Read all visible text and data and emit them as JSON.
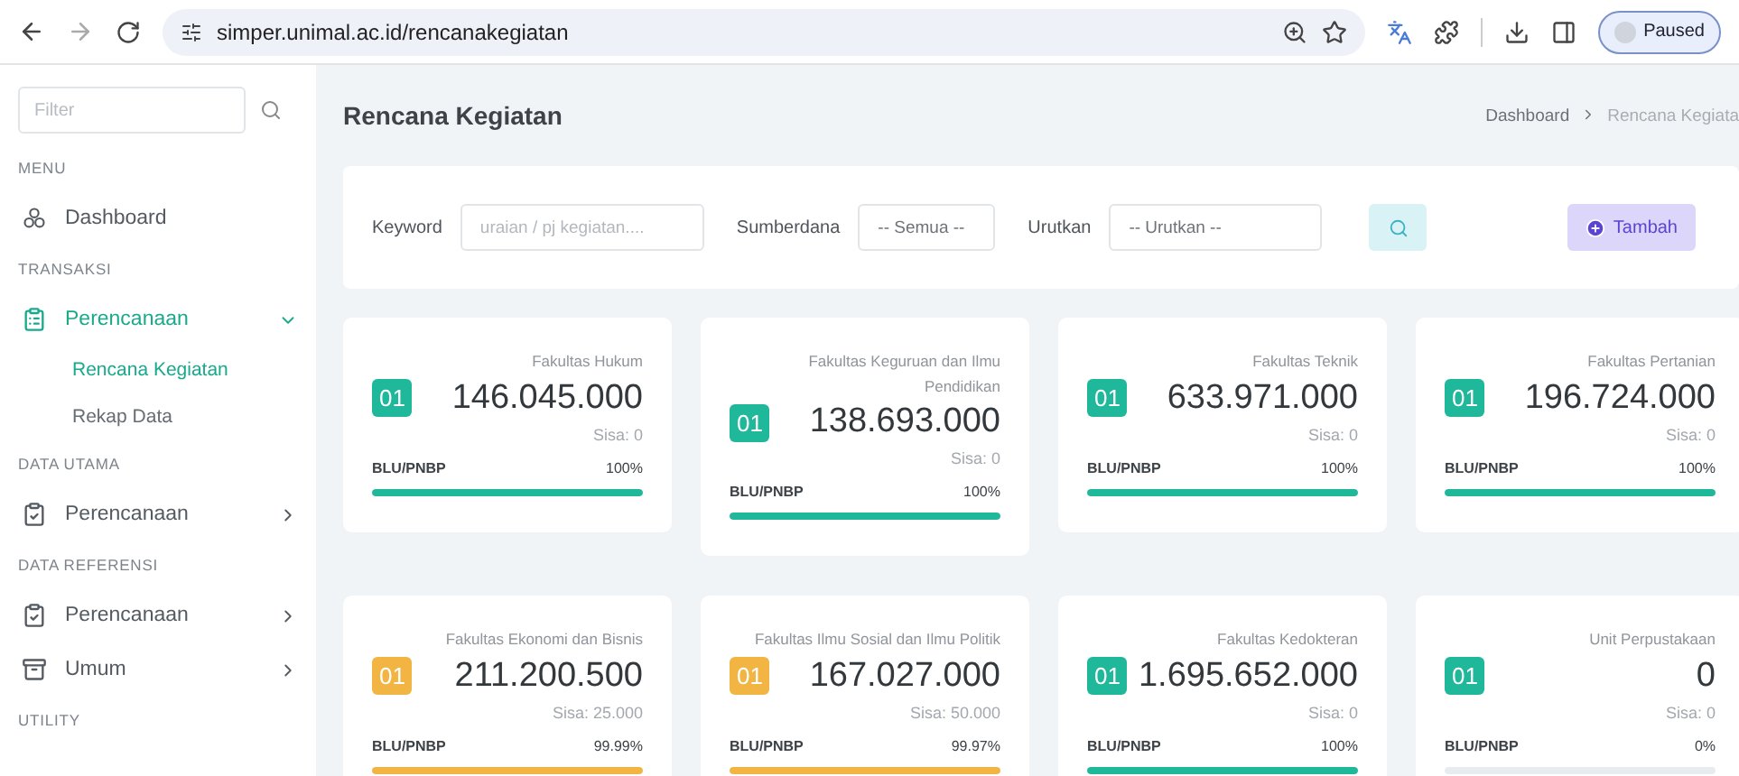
{
  "browser": {
    "url": "simper.unimal.ac.id/rencanakegiatan",
    "profile": "Paused"
  },
  "sidebar": {
    "filter": {
      "placeholder": "Filter"
    },
    "groups": [
      {
        "heading": "MENU",
        "items": [
          {
            "label": "Dashboard",
            "selected": false
          }
        ]
      },
      {
        "heading": "TRANSAKSI",
        "items": [
          {
            "label": "Perencanaan",
            "selected": true,
            "expanded": true,
            "children": [
              {
                "label": "Rencana Kegiatan",
                "selected": true
              },
              {
                "label": "Rekap Data",
                "selected": false
              }
            ]
          }
        ]
      },
      {
        "heading": "DATA UTAMA",
        "items": [
          {
            "label": "Perencanaan",
            "selected": false,
            "expanded": false
          }
        ]
      },
      {
        "heading": "DATA REFERENSI",
        "items": [
          {
            "label": "Perencanaan",
            "selected": false,
            "expanded": false
          },
          {
            "label": "Umum",
            "selected": false,
            "expanded": false
          }
        ]
      },
      {
        "heading": "UTILITY"
      }
    ]
  },
  "page": {
    "title": "Rencana Kegiatan",
    "breadcrumb": [
      "Dashboard",
      "Rencana Kegiata"
    ]
  },
  "filters": {
    "keyword_label": "Keyword",
    "keyword_placeholder": "uraian / pj kegiatan....",
    "source_label": "Sumberdana",
    "source_value": "-- Semua --",
    "sort_label": "Urutkan",
    "sort_value": "-- Urutkan --",
    "add_button": "Tambah"
  },
  "cards": [
    {
      "unit": "Fakultas Hukum",
      "code": "01",
      "color": "#1fb89a",
      "amount": "146.045.000",
      "remainder": "Sisa: 0",
      "source": "BLU/PNBP",
      "percent": "100%",
      "level": 1
    },
    {
      "unit": "Fakultas Keguruan dan Ilmu Pendidikan",
      "code": "01",
      "color": "#1fb89a",
      "amount": "138.693.000",
      "remainder": "Sisa: 0",
      "source": "BLU/PNBP",
      "percent": "100%",
      "level": 1
    },
    {
      "unit": "Fakultas Teknik",
      "code": "01",
      "color": "#1fb89a",
      "amount": "633.971.000",
      "remainder": "Sisa: 0",
      "source": "BLU/PNBP",
      "percent": "100%",
      "level": 1
    },
    {
      "unit": "Fakultas Pertanian",
      "code": "01",
      "color": "#1fb89a",
      "amount": "196.724.000",
      "remainder": "Sisa: 0",
      "source": "BLU/PNBP",
      "percent": "100%",
      "level": 1
    },
    {
      "unit": "Fakultas Ekonomi dan Bisnis",
      "code": "01",
      "color": "#f2b544",
      "amount": "211.200.500",
      "remainder": "Sisa: 25.000",
      "source": "BLU/PNBP",
      "percent": "99.99%",
      "level": 0.9999
    },
    {
      "unit": "Fakultas Ilmu Sosial dan Ilmu Politik",
      "code": "01",
      "color": "#f2b544",
      "amount": "167.027.000",
      "remainder": "Sisa: 50.000",
      "source": "BLU/PNBP",
      "percent": "99.97%",
      "level": 0.9997
    },
    {
      "unit": "Fakultas Kedokteran",
      "code": "01",
      "color": "#1fb89a",
      "amount": "1.695.652.000",
      "remainder": "Sisa: 0",
      "source": "BLU/PNBP",
      "percent": "100%",
      "level": 1
    },
    {
      "unit": "Unit Perpustakaan",
      "code": "01",
      "color": "#1fb89a",
      "amount": "0",
      "remainder": "Sisa: 0",
      "source": "BLU/PNBP",
      "percent": "0%",
      "level": 0
    }
  ]
}
